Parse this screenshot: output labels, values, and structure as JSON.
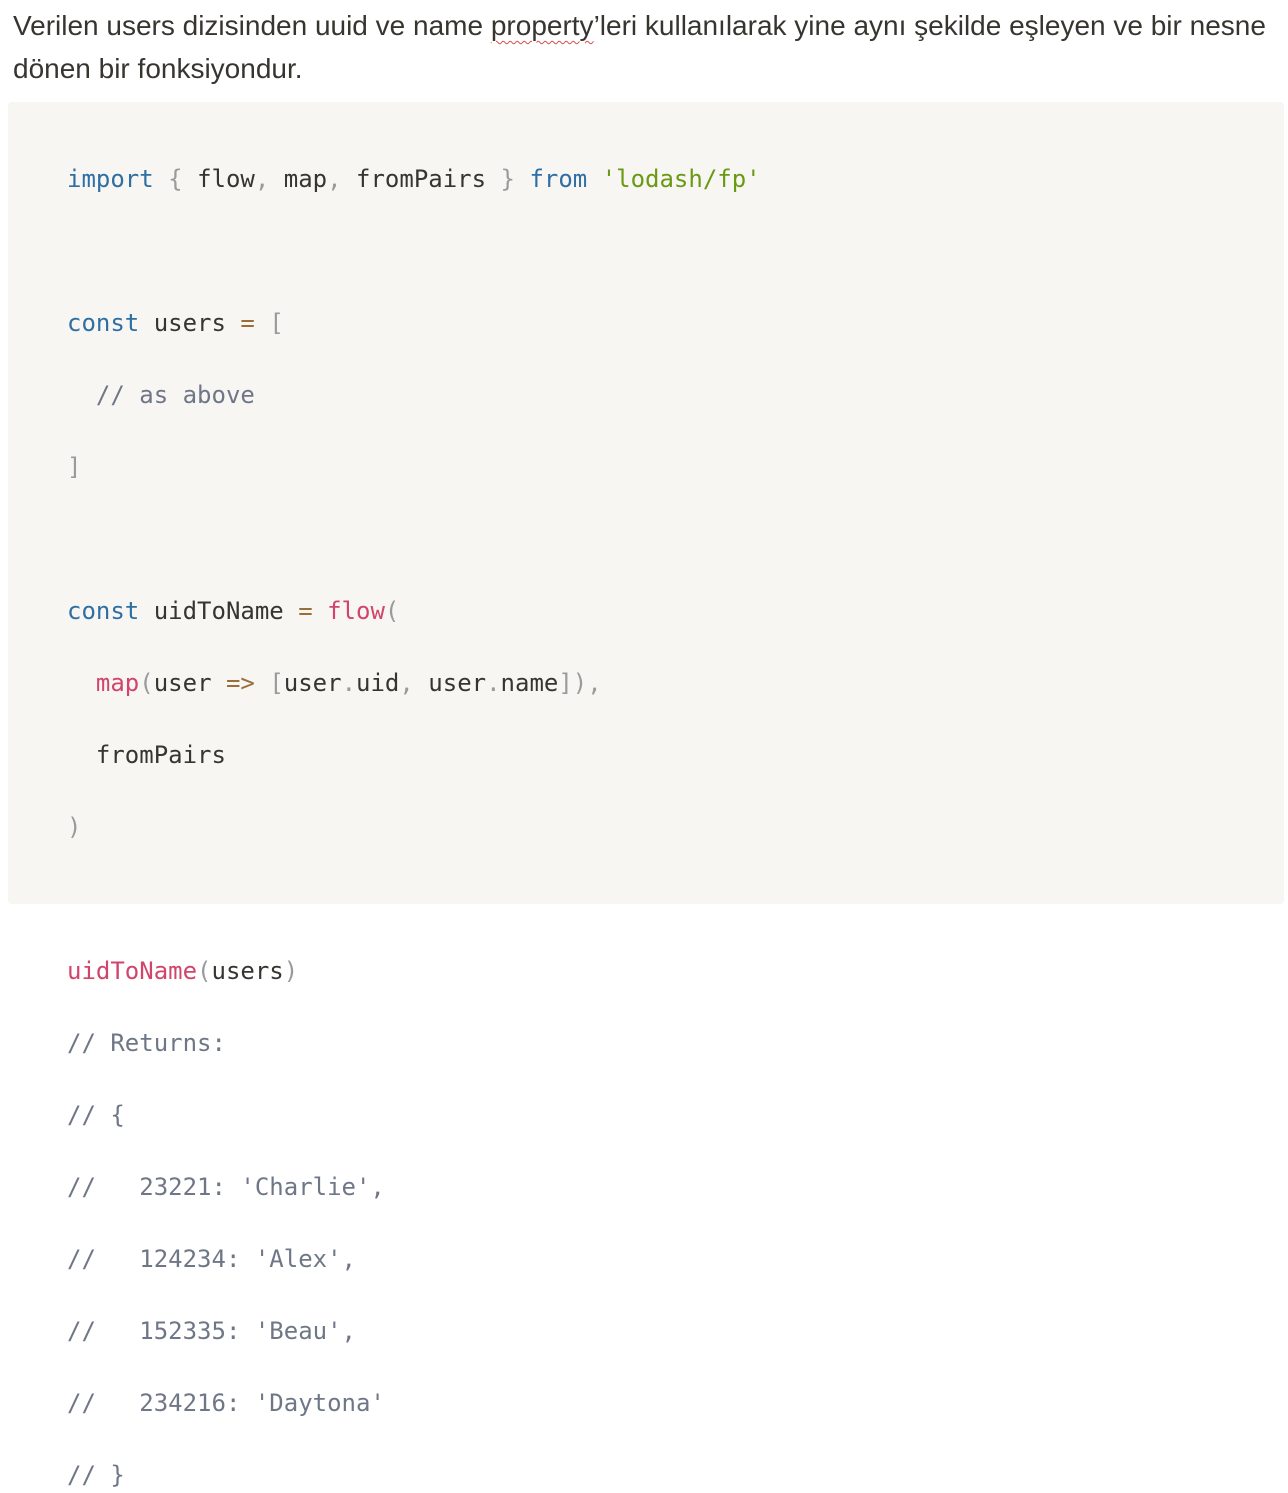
{
  "paragraph": {
    "before": "Verilen users dizisinden uuid ve name ",
    "flagged_word": "property",
    "after": "’leri kullanılarak yine aynı şekilde eşleyen ve bir nesne dönen bir fonksiyondur."
  },
  "code": {
    "import_kw": "import",
    "brace_open": "{",
    "imp_flow": "flow",
    "comma": ",",
    "imp_map": "map",
    "imp_fromPairs": "fromPairs",
    "brace_close": "}",
    "from_kw": "from",
    "module": "'lodash/fp'",
    "const_kw": "const",
    "users_var": "users",
    "eq": "=",
    "bracket_open": "[",
    "as_above_comment": "// as above",
    "bracket_close": "]",
    "uidToName_var": "uidToName",
    "flow_call": "flow",
    "paren_open": "(",
    "map_call": "map",
    "param_user": "user",
    "arrow": "=>",
    "user_obj": "user",
    "dot": ".",
    "prop_uid": "uid",
    "prop_name": "name",
    "close_map": "]),",
    "fromPairs_arg": "fromPairs",
    "paren_close": ")",
    "call_fn": "uidToName",
    "call_arg": "users",
    "comments": [
      "// Returns:",
      "// {",
      "//   23221: 'Charlie',",
      "//   124234: 'Alex',",
      "//   152335: 'Beau',",
      "//   234216: 'Daytona'",
      "// }"
    ]
  }
}
